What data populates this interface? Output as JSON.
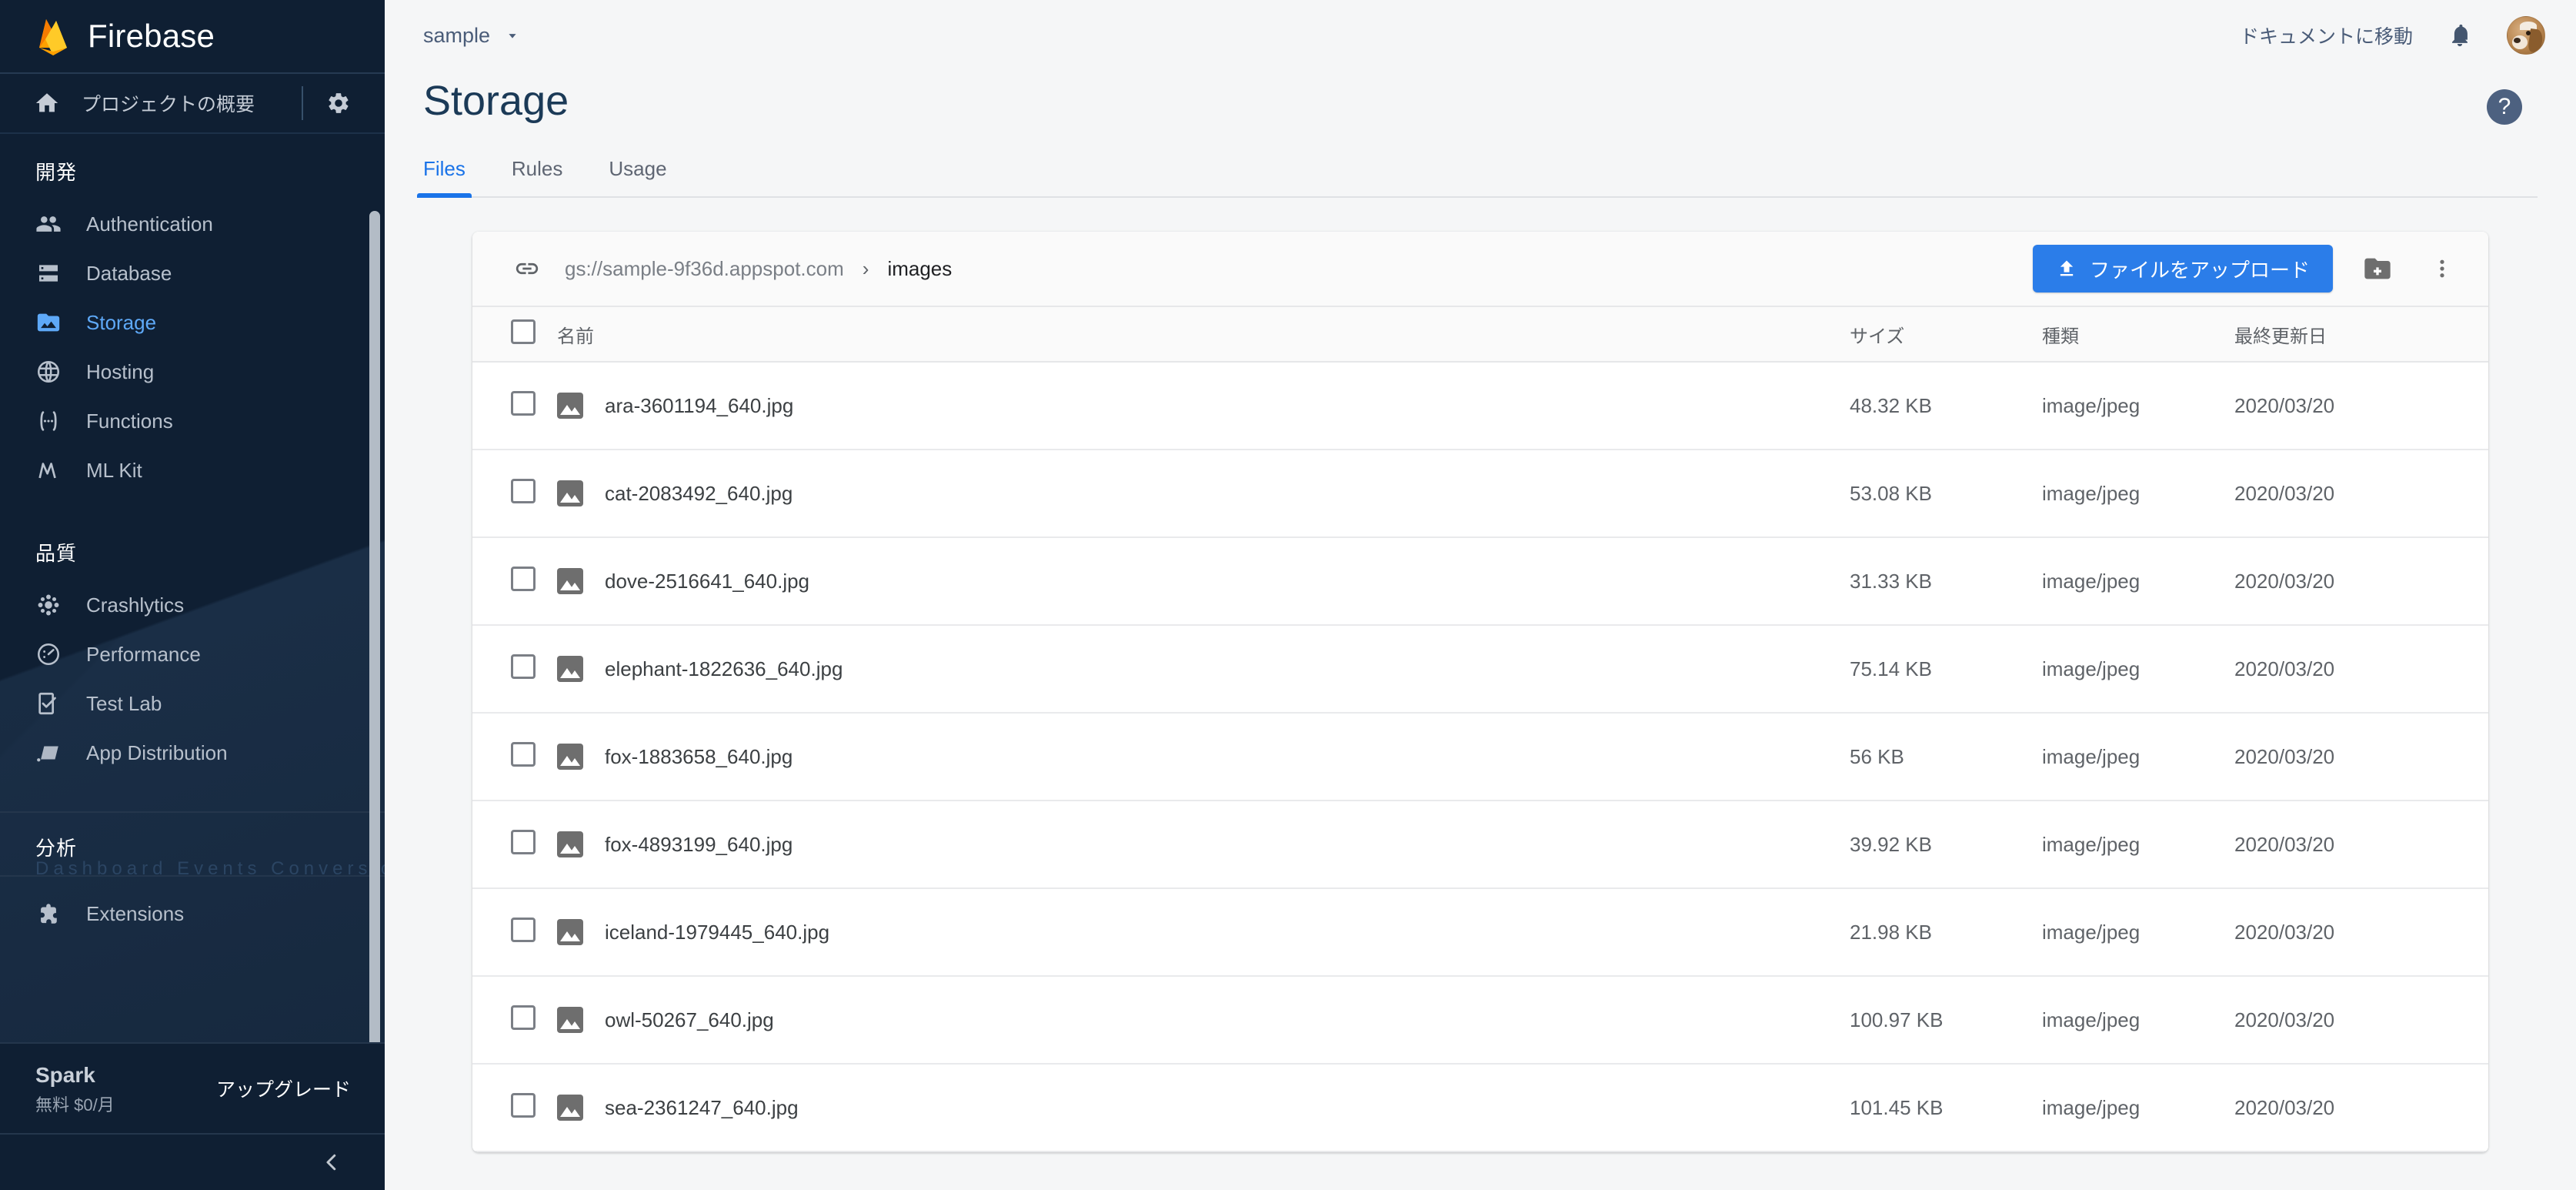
{
  "sidebar": {
    "brand": "Firebase",
    "overview": {
      "label": "プロジェクトの概要",
      "home_icon": "home-icon",
      "settings_icon": "gear-icon"
    },
    "sections": [
      {
        "title": "開発",
        "items": [
          {
            "label": "Authentication",
            "icon": "people-icon",
            "active": false
          },
          {
            "label": "Database",
            "icon": "database-icon",
            "active": false
          },
          {
            "label": "Storage",
            "icon": "image-folder-icon",
            "active": true
          },
          {
            "label": "Hosting",
            "icon": "globe-icon",
            "active": false
          },
          {
            "label": "Functions",
            "icon": "functions-icon",
            "active": false
          },
          {
            "label": "ML Kit",
            "icon": "ml-kit-icon",
            "active": false
          }
        ]
      },
      {
        "title": "品質",
        "items": [
          {
            "label": "Crashlytics",
            "icon": "crashlytics-icon",
            "active": false
          },
          {
            "label": "Performance",
            "icon": "speedometer-icon",
            "active": false
          },
          {
            "label": "Test Lab",
            "icon": "test-lab-icon",
            "active": false
          },
          {
            "label": "App Distribution",
            "icon": "app-distribution-icon",
            "active": false
          }
        ]
      },
      {
        "title": "分析",
        "ghost": "Dashboard  Events  Conversions",
        "items": [
          {
            "label": "Extensions",
            "icon": "extensions-icon",
            "active": false
          }
        ]
      }
    ],
    "plan": {
      "name": "Spark",
      "detail": "無料 $0/月",
      "upgrade": "アップグレード"
    },
    "collapse_icon": "chevron-left-icon"
  },
  "topbar": {
    "project": "sample",
    "project_caret": "chevron-down-icon",
    "docs_link": "ドキュメントに移動",
    "bell_icon": "bell-icon",
    "avatar": "user-avatar"
  },
  "page": {
    "title": "Storage",
    "tabs": [
      {
        "label": "Files",
        "active": true
      },
      {
        "label": "Rules",
        "active": false
      },
      {
        "label": "Usage",
        "active": false
      }
    ],
    "help_icon": "help-icon",
    "help_label": "?"
  },
  "toolbar": {
    "link_icon": "link-icon",
    "bucket": "gs://sample-9f36d.appspot.com",
    "separator": "›",
    "current_folder": "images",
    "upload_label": "ファイルをアップロード",
    "upload_icon": "upload-icon",
    "new_folder_icon": "new-folder-icon",
    "more_icon": "more-vert-icon",
    "accent_color": "#2b7de9"
  },
  "table": {
    "headers": {
      "name": "名前",
      "size": "サイズ",
      "type": "種類",
      "updated": "最終更新日"
    },
    "rows": [
      {
        "name": "ara-3601194_640.jpg",
        "size": "48.32 KB",
        "type": "image/jpeg",
        "updated": "2020/03/20"
      },
      {
        "name": "cat-2083492_640.jpg",
        "size": "53.08 KB",
        "type": "image/jpeg",
        "updated": "2020/03/20"
      },
      {
        "name": "dove-2516641_640.jpg",
        "size": "31.33 KB",
        "type": "image/jpeg",
        "updated": "2020/03/20"
      },
      {
        "name": "elephant-1822636_640.jpg",
        "size": "75.14 KB",
        "type": "image/jpeg",
        "updated": "2020/03/20"
      },
      {
        "name": "fox-1883658_640.jpg",
        "size": "56 KB",
        "type": "image/jpeg",
        "updated": "2020/03/20"
      },
      {
        "name": "fox-4893199_640.jpg",
        "size": "39.92 KB",
        "type": "image/jpeg",
        "updated": "2020/03/20"
      },
      {
        "name": "iceland-1979445_640.jpg",
        "size": "21.98 KB",
        "type": "image/jpeg",
        "updated": "2020/03/20"
      },
      {
        "name": "owl-50267_640.jpg",
        "size": "100.97 KB",
        "type": "image/jpeg",
        "updated": "2020/03/20"
      },
      {
        "name": "sea-2361247_640.jpg",
        "size": "101.45 KB",
        "type": "image/jpeg",
        "updated": "2020/03/20"
      }
    ]
  }
}
